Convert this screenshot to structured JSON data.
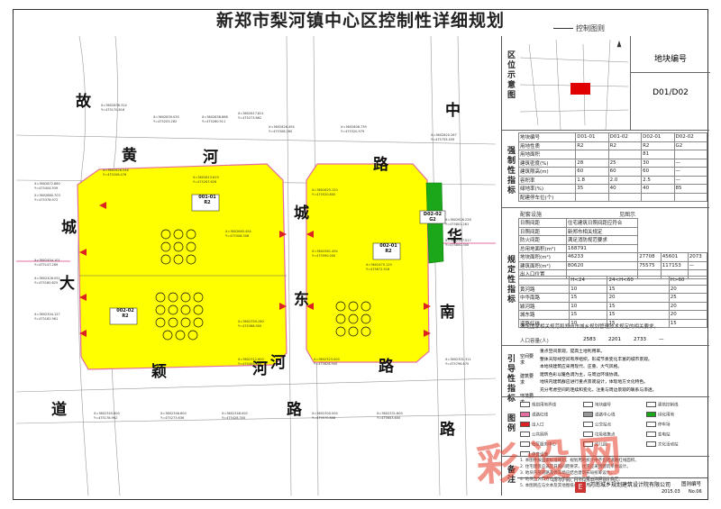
{
  "header": {
    "title": "新郑市梨河镇中心区控制性详细规划",
    "subtitle": "控制图则"
  },
  "roads": {
    "w1": "故",
    "w2": "黄",
    "w3": "河",
    "w4": "路",
    "w5": "城",
    "w6": "大",
    "w7": "颖",
    "w8": "道",
    "c1": "城",
    "c2": "东",
    "c3": "河",
    "c4": "路",
    "e1": "中",
    "e2": "华",
    "e3": "南",
    "e4": "路",
    "s1": "河",
    "s2": "路"
  },
  "plots": {
    "p1": "001-01",
    "p1_type": "R2",
    "p2": "002-02",
    "p2_type": "R2",
    "p3": "002-01",
    "p3_type": "R2",
    "p4": "D02-02",
    "p4_type": "G2"
  },
  "side": {
    "location_label": "区位示意图",
    "plot_no_title": "地块编号",
    "plot_no_value": "D01/D02",
    "control_label": "强制性指标",
    "guide_label": "规定性指标",
    "lead_label": "引导性指标",
    "legend_label": "图例",
    "note_label": "备注",
    "table_rows": [
      [
        "地块编号",
        "D01-01",
        "D01-02",
        "D02-01",
        "D02-02"
      ],
      [
        "用地性质",
        "R2",
        "R2",
        "R2",
        "G2"
      ],
      [
        "用地面积",
        "",
        "",
        "81",
        ""
      ],
      [
        "建筑密度(%)",
        "28",
        "25",
        "30",
        "—"
      ],
      [
        "建筑限高(m)",
        "60",
        "60",
        "60",
        "—"
      ],
      [
        "容积率",
        "1.8",
        "2.0",
        "2.5",
        "—"
      ],
      [
        "绿地率(%)",
        "35",
        "40",
        "40",
        "85"
      ],
      [
        "配建停车位(个)",
        "",
        "",
        "",
        ""
      ]
    ],
    "supply_label": "配套设施",
    "supply_value": "见图示",
    "rows2": [
      [
        "日照间距",
        "住宅建筑日照间距应符合"
      ],
      [
        "日照间距",
        "新郑市相关规定"
      ],
      [
        "防火间距",
        "满足消防规范要求"
      ],
      [
        "总用地面积(m²)",
        "168791"
      ],
      [
        "地块面积(m²)",
        "46233",
        "27708",
        "45601",
        "2073"
      ],
      [
        "建筑面积(m²)",
        "80620",
        "75575",
        "117153",
        "—"
      ],
      [
        "出入口位置",
        "",
        "",
        "",
        ""
      ]
    ],
    "setback_head": [
      "",
      "H<24",
      "24<H<60",
      "H>60"
    ],
    "setback_rows": [
      [
        "黄河路",
        "10",
        "15",
        "20"
      ],
      [
        "中华南路",
        "15",
        "20",
        "25"
      ],
      [
        "颖河路",
        "10",
        "15",
        "20"
      ],
      [
        "城东路",
        "15",
        "15",
        "20"
      ],
      [
        "道路红线",
        "10",
        "15",
        "15"
      ]
    ],
    "standard": "满足国家相关规范和郑州市城乡规划管理技术规定的相关要求。",
    "population_label": "人口容量(人)",
    "population": [
      "2583",
      "2201",
      "2733",
      "—"
    ],
    "lead_rows": [
      "重点空间景观，提高土地利用率。",
      "整体天际线空间有序组织，形成节奏变化丰富的城市景观。",
      "本地块建筑应采用现代、庄重、大气风格。",
      "建筑色彩以暖色调为主，与周边环境协调。",
      "地块内建筑群应进行重点景观设计，体现地方文化特色。",
      "充分考虑空间的连续和变化，注重与周边景观的联系与渗透。"
    ],
    "lead_tags": [
      "空间要求",
      "建筑要求",
      "环境要求"
    ],
    "legend": [
      "规划用地界线",
      "地块编号",
      "建筑控制线",
      "道路红线",
      "道路中心线",
      "绿化用地",
      "出入口",
      "公交站点",
      "停车场",
      "公共厕所",
      "垃圾收集点",
      "变电站",
      "社区服务中心",
      "幼儿园",
      "文化活动站",
      "体育设施"
    ],
    "notes": [
      "1. 本图件按国家标准规划，规划用地统计中不包括道路红线面积。",
      "2. 住宅建筑应满足日照间距要求，住宅应采用建筑单体设计。",
      "3. 地块内部道路及停车场应结合建筑布局统筹设计。",
      "4. 地块出入口方位仅为示意，具体位置由详细设计确定。",
      "5. 本图则应与文本及其他图纸共同使用。"
    ],
    "footer_company": "河南城乡规划建筑设计院有限公司",
    "footer_date": "2015.03",
    "footer_no_label": "图则编号",
    "footer_no": "No.06"
  },
  "watermark": {
    "big": "彩 设 网",
    "url": "www.mizhi.com"
  }
}
